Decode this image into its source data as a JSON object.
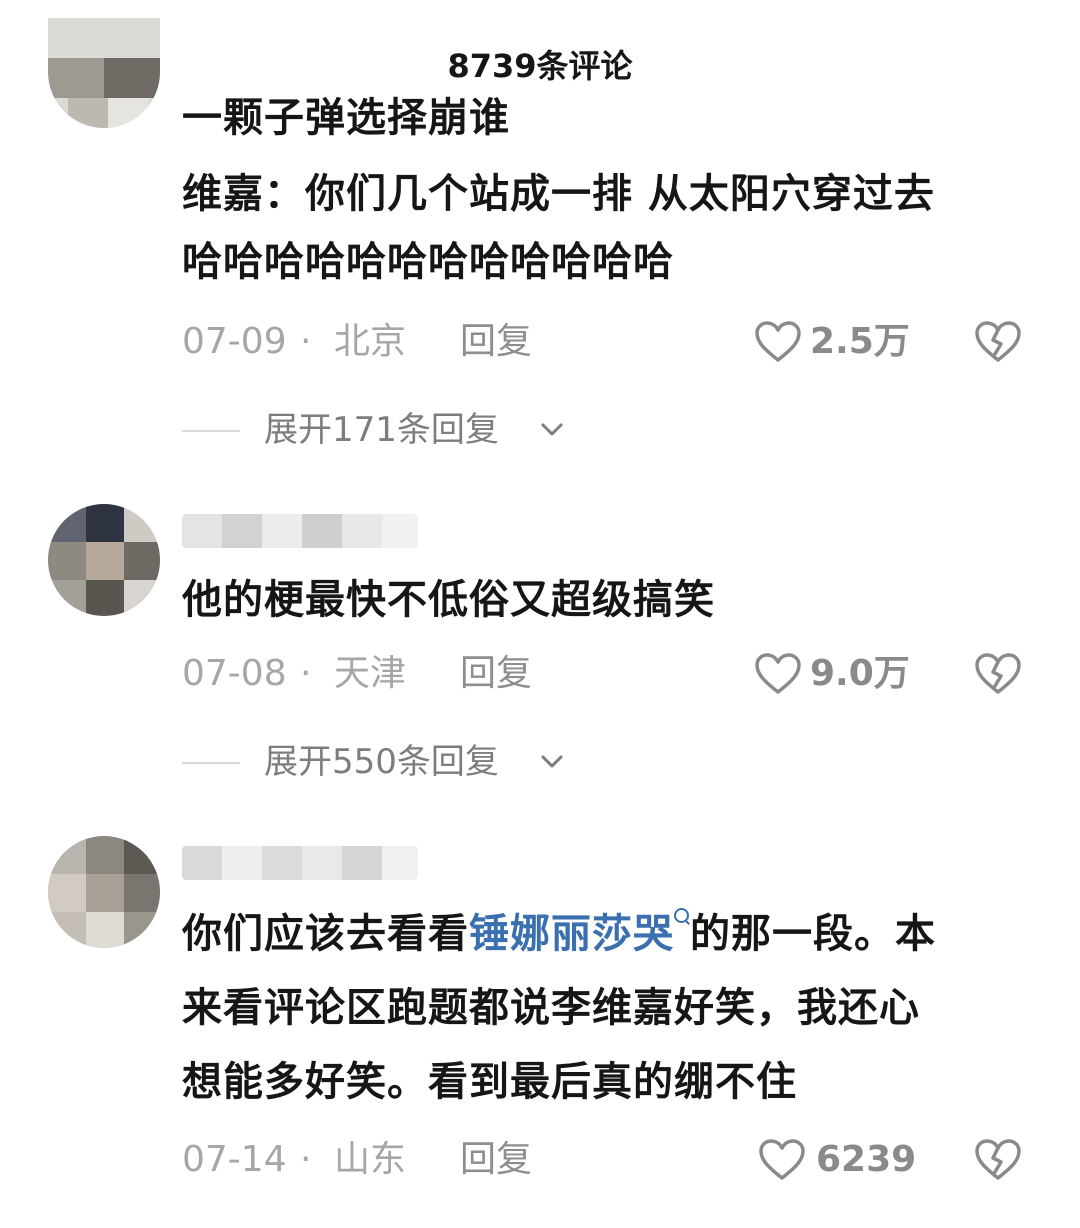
{
  "header": {
    "title": "8739条评论"
  },
  "comments": [
    {
      "lines": [
        "一颗子弹选择崩谁",
        "维嘉：你们几个站成一排 从太阳穴穿过去",
        "哈哈哈哈哈哈哈哈哈哈哈哈"
      ],
      "date": "07-09",
      "dot": "·",
      "location": "北京",
      "reply_label": "回复",
      "like_count": "2.5万",
      "expand_label": "展开171条回复"
    },
    {
      "lines": [
        "他的梗最快不低俗又超级搞笑"
      ],
      "date": "07-08",
      "dot": "·",
      "location": "天津",
      "reply_label": "回复",
      "like_count": "9.0万",
      "expand_label": "展开550条回复"
    },
    {
      "line1_before": "你们应该去看看",
      "line1_link": "锤娜丽莎哭",
      "line1_after": "的那一段。本",
      "line2": "来看评论区跑题都说李维嘉好笑，我还心",
      "line3": "想能多好笑。看到最后真的绷不住",
      "date": "07-14",
      "dot": "·",
      "location": "山东",
      "reply_label": "回复",
      "like_count": "6239"
    }
  ],
  "icons": {
    "like": "heart-outline-icon",
    "dislike": "broken-heart-icon",
    "expand": "chevron-down-icon",
    "topic_search": "search-icon"
  },
  "colors": {
    "text": "#161616",
    "meta": "#a6a6a6",
    "link": "#3a6fb0"
  }
}
